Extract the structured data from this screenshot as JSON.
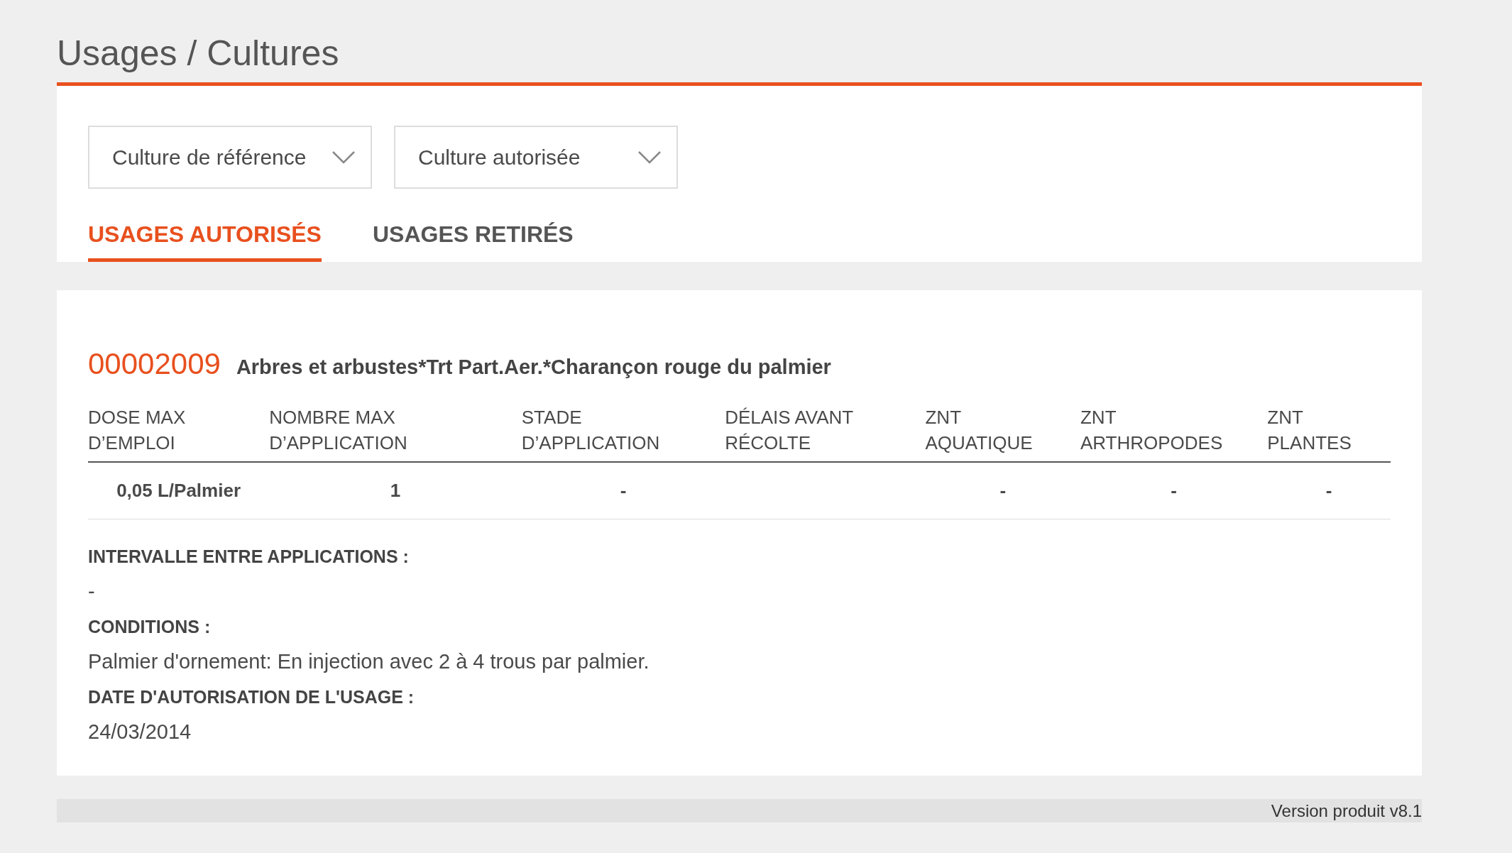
{
  "page": {
    "title": "Usages / Cultures"
  },
  "filters": [
    {
      "placeholder": "Culture de référence"
    },
    {
      "placeholder": "Culture autorisée"
    }
  ],
  "tabs": [
    {
      "label": "USAGES AUTORISÉS",
      "selected": true
    },
    {
      "label": "USAGES RETIRÉS",
      "selected": false
    }
  ],
  "usage": {
    "code": "00002009",
    "name": "Arbres et arbustes*Trt Part.Aer.*Charançon rouge du palmier",
    "table": {
      "columns": [
        "DOSE MAX\nD’EMPLOI",
        "NOMBRE MAX\nD’APPLICATION",
        "STADE\nD’APPLICATION",
        "DÉLAIS AVANT\nRÉCOLTE",
        "ZNT\nAQUATIQUE",
        "ZNT\nARTHROPODES",
        "ZNT\nPLANTES"
      ],
      "rows": [
        [
          "0,05 L/Palmier",
          "1",
          "-",
          "",
          "-",
          "-",
          "-"
        ]
      ]
    },
    "details": [
      {
        "label": "INTERVALLE ENTRE APPLICATIONS :",
        "value": "-"
      },
      {
        "label": "CONDITIONS :",
        "value": "Palmier d'ornement: En injection avec 2 à 4 trous par palmier."
      },
      {
        "label": "DATE D'AUTORISATION DE L'USAGE :",
        "value": "24/03/2014"
      }
    ]
  },
  "footer": {
    "version": "Version produit v8.1"
  }
}
